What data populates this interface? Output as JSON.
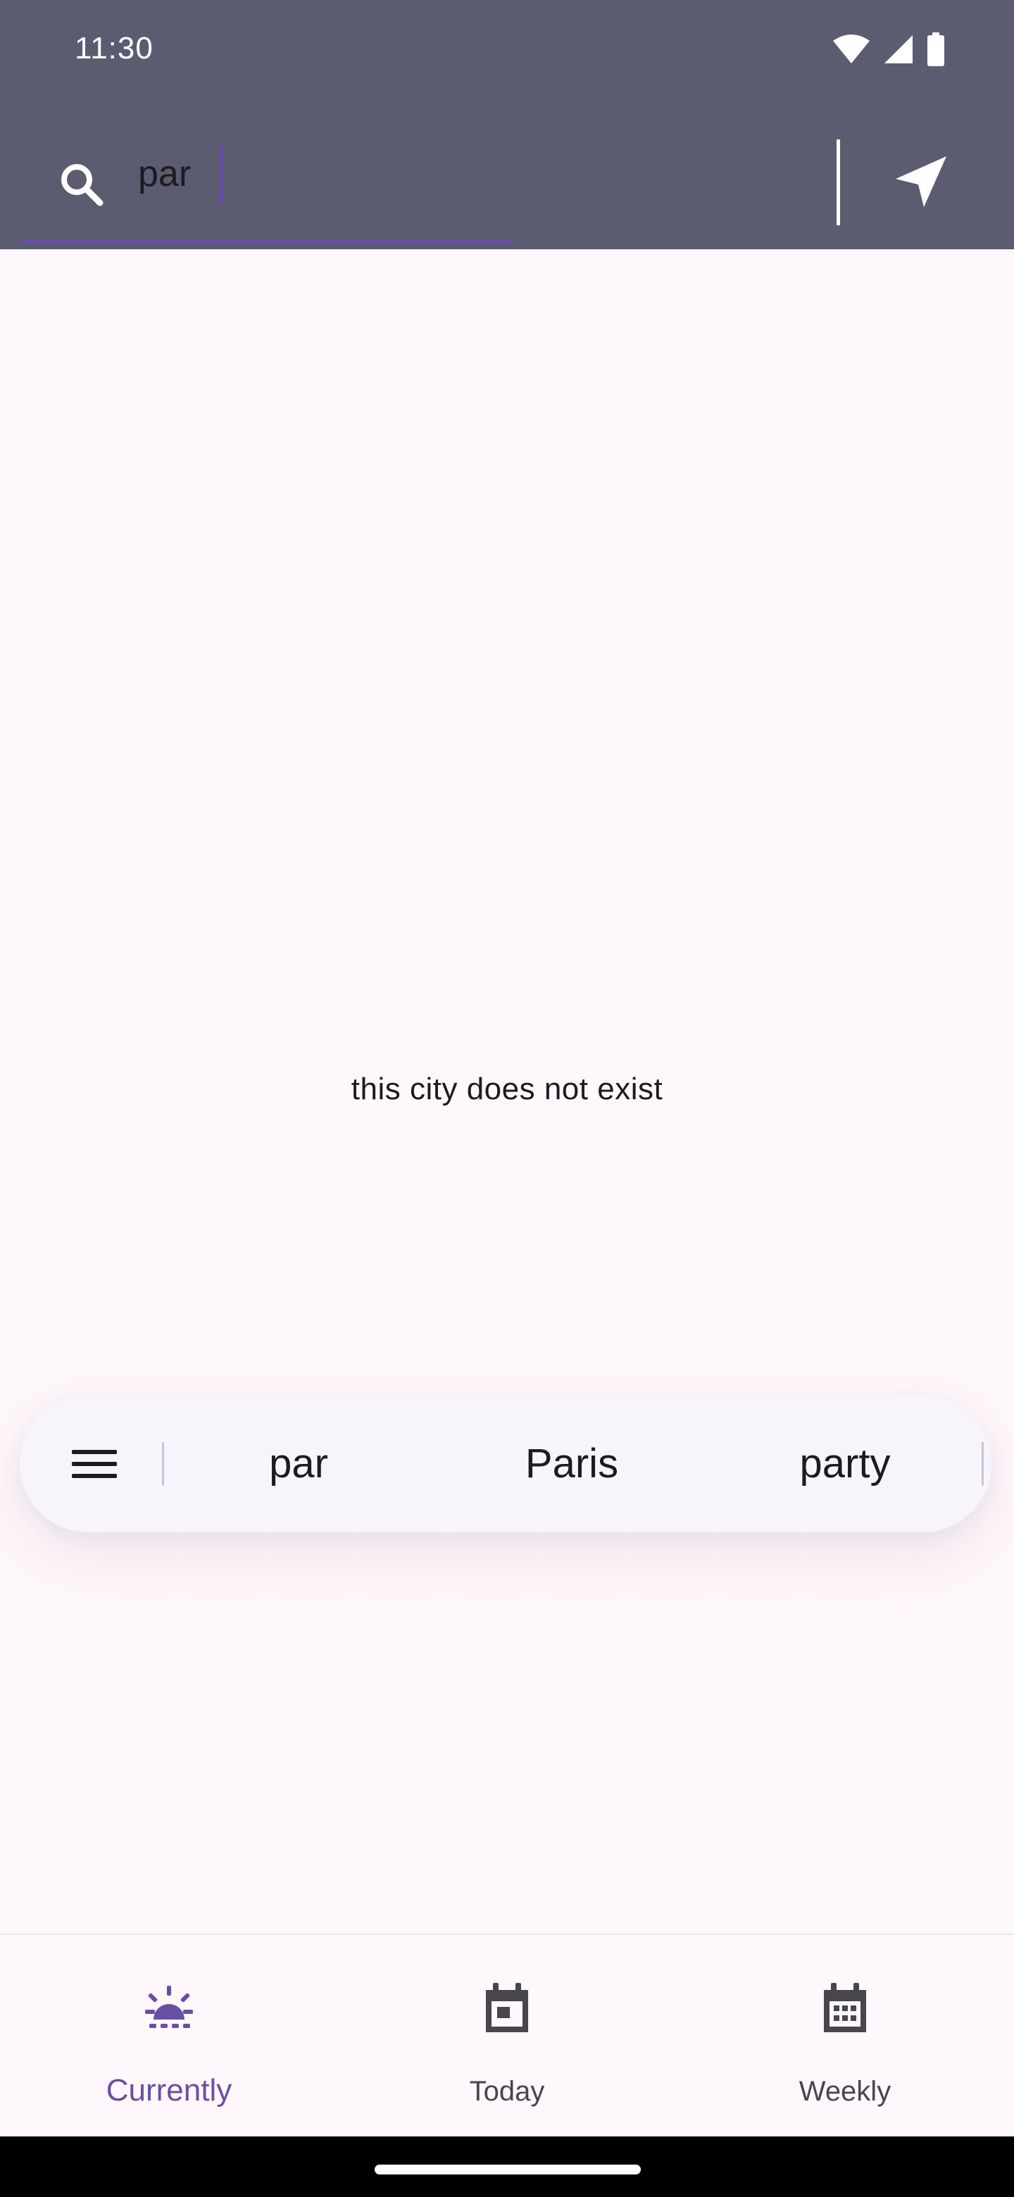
{
  "status_bar": {
    "time": "11:30",
    "icons": [
      "wifi-icon",
      "cellular-signal-icon",
      "battery-icon"
    ]
  },
  "search": {
    "value": "par",
    "icon": "search-icon",
    "location_icon": "navigation-arrow-icon"
  },
  "main": {
    "message": "this city does not exist"
  },
  "keyboard_suggestions": {
    "menu_icon": "menu-icon",
    "items": [
      "par",
      "Paris",
      "party"
    ]
  },
  "bottom_nav": {
    "items": [
      {
        "label": "Currently",
        "icon": "sun-icon",
        "active": true
      },
      {
        "label": "Today",
        "icon": "calendar-today-icon",
        "active": false
      },
      {
        "label": "Weekly",
        "icon": "calendar-month-icon",
        "active": false
      }
    ]
  },
  "colors": {
    "app_bar": "#5b5c70",
    "background": "#fef7fb",
    "accent": "#6750a4",
    "text": "#1d1b20",
    "nav_inactive": "#49454f"
  }
}
